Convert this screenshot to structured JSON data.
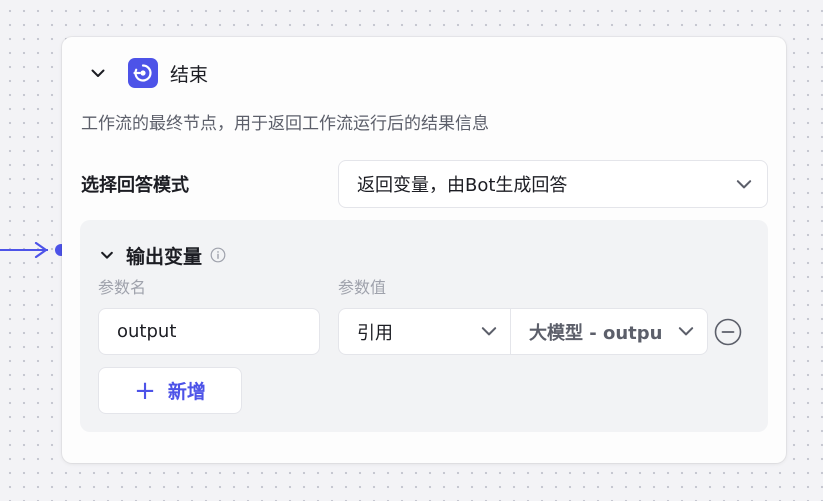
{
  "node": {
    "title": "结束",
    "description": "工作流的最终节点，用于返回工作流运行后的结果信息"
  },
  "answer_mode": {
    "label": "选择回答模式",
    "selected": "返回变量，由Bot生成回答"
  },
  "output_vars": {
    "title": "输出变量",
    "col_name": "参数名",
    "col_value": "参数值",
    "rows": [
      {
        "name": "output",
        "ref_type": "引用",
        "ref_value": "大模型 - output"
      }
    ],
    "add_label": "新增"
  },
  "colors": {
    "accent": "#4d53e8",
    "canvas_bg": "#f3f3f6",
    "panel_bg": "#f2f3f5"
  },
  "icons": [
    "chevron-down-icon",
    "end-node-icon",
    "info-icon",
    "minus-circle-icon",
    "plus-icon",
    "arrow-right-icon"
  ]
}
